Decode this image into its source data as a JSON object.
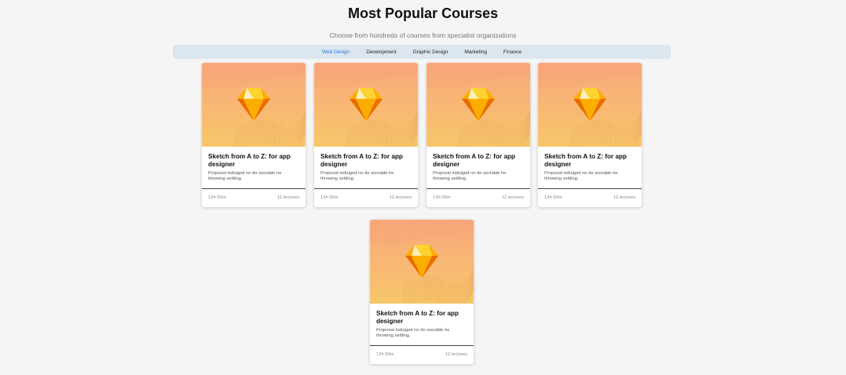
{
  "header": {
    "title": "Most Popular Courses",
    "subtitle": "Choose from hundreds of courses from specialist organizations"
  },
  "tabs": [
    {
      "label": "Web Design",
      "active": true
    },
    {
      "label": "Development",
      "active": false
    },
    {
      "label": "Graphic Design",
      "active": false
    },
    {
      "label": "Marketing",
      "active": false
    },
    {
      "label": "Finance",
      "active": false
    }
  ],
  "courses": [
    {
      "title": "Sketch from A to Z: for app designer",
      "description": "Proposal indulged no do sociable he throwing settling.",
      "duration": "12h 56m",
      "lectures": "12 lectures",
      "icon": "sketch-diamond-icon"
    },
    {
      "title": "Sketch from A to Z: for app designer",
      "description": "Proposal indulged no do sociable he throwing settling.",
      "duration": "12h 56m",
      "lectures": "12 lectures",
      "icon": "sketch-diamond-icon"
    },
    {
      "title": "Sketch from A to Z: for app designer",
      "description": "Proposal indulged no do sociable he throwing settling.",
      "duration": "12h 56m",
      "lectures": "12 lectures",
      "icon": "sketch-diamond-icon"
    },
    {
      "title": "Sketch from A to Z: for app designer",
      "description": "Proposal indulged no do sociable he throwing settling.",
      "duration": "12h 56m",
      "lectures": "12 lectures",
      "icon": "sketch-diamond-icon"
    },
    {
      "title": "Sketch from A to Z: for app designer",
      "description": "Proposal indulged no do sociable he throwing settling.",
      "duration": "12h 56m",
      "lectures": "12 lectures",
      "icon": "sketch-diamond-icon"
    }
  ],
  "colors": {
    "accent": "#2a7ae4",
    "tab_bar": "#dce6ef",
    "thumb_top": "#f9a77d",
    "thumb_bottom": "#f7c76a"
  }
}
